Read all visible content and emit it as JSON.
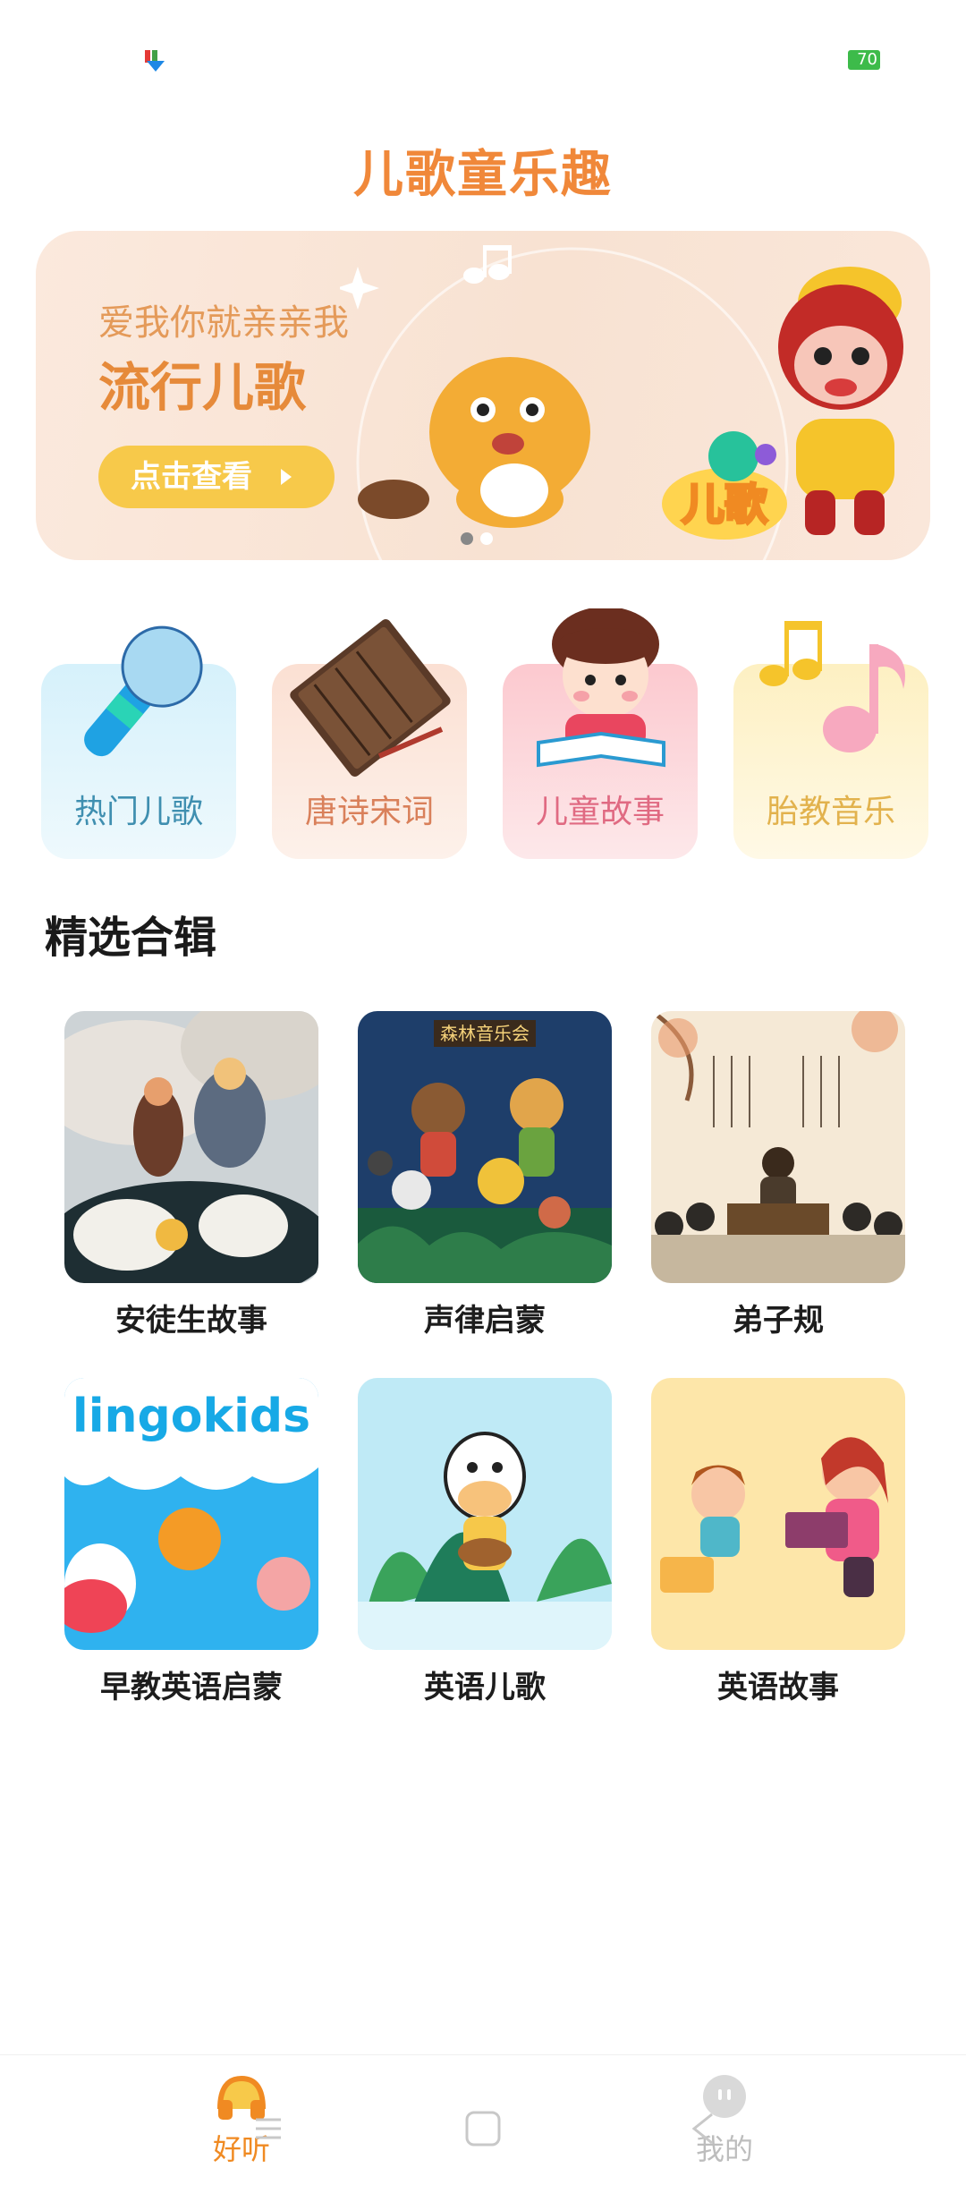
{
  "status": {
    "battery": "70"
  },
  "app": {
    "title": "儿歌童乐趣"
  },
  "banner": {
    "subtitle": "爱我你就亲亲我",
    "title": "流行儿歌",
    "button": "点击查看",
    "badge": "儿歌"
  },
  "categories": [
    {
      "label": "热门儿歌",
      "icon": "microphone-icon"
    },
    {
      "label": "唐诗宋词",
      "icon": "book-scroll-icon"
    },
    {
      "label": "儿童故事",
      "icon": "girl-reading-icon"
    },
    {
      "label": "胎教音乐",
      "icon": "music-note-icon"
    }
  ],
  "section": {
    "title": "精选合辑"
  },
  "albums": [
    {
      "name": "安徒生故事"
    },
    {
      "name": "声律启蒙",
      "cover_text": "森林音乐会"
    },
    {
      "name": "弟子规"
    },
    {
      "name": "早教英语启蒙",
      "cover_text": "lingokids"
    },
    {
      "name": "英语儿歌"
    },
    {
      "name": "英语故事"
    }
  ],
  "nav": {
    "tabs": [
      {
        "label": "好听",
        "active": true
      },
      {
        "label": "我的",
        "active": false
      }
    ]
  },
  "colors": {
    "accent": "#f0883a",
    "banner_bg": "#f8e2d2",
    "button_yellow": "#f7c94a"
  }
}
